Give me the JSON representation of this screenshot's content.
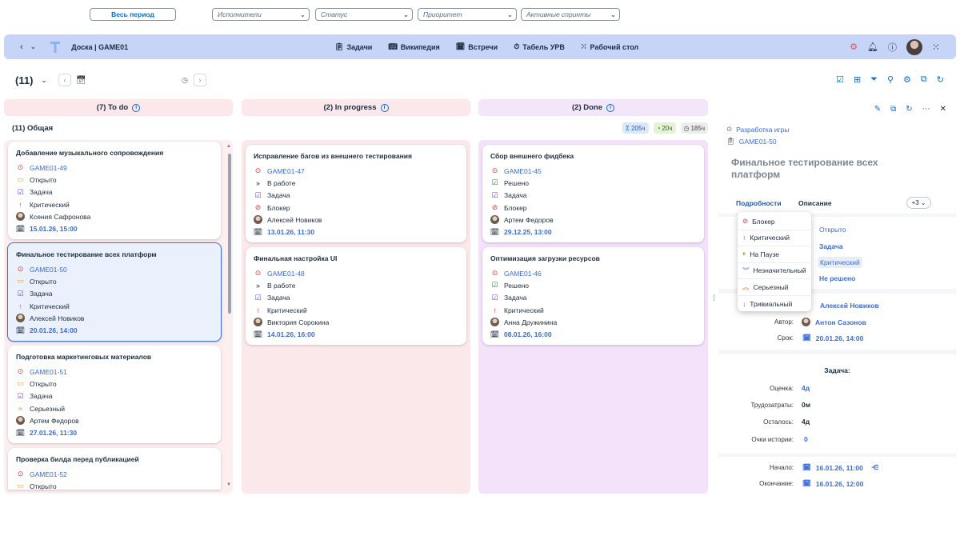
{
  "header": {
    "title": "Доска | GAME01",
    "menu": [
      {
        "label": "Задачи",
        "icon": "clipboard-icon"
      },
      {
        "label": "Википедия",
        "icon": "book-icon"
      },
      {
        "label": "Встречи",
        "icon": "calendar-people-icon"
      },
      {
        "label": "Табель УРВ",
        "icon": "clock-sheet-icon"
      },
      {
        "label": "Рабочий стол",
        "icon": "grid-dots-icon"
      }
    ]
  },
  "filters": {
    "count": "(11)",
    "period": "Весь период",
    "assignees": "Исполнители",
    "status": "Статус",
    "priority": "Приоритет",
    "sprints": "Активные спринты"
  },
  "board": {
    "group_title": "(11) Общая",
    "badges": [
      {
        "label": "205ч",
        "icon": "sigma-icon",
        "bg": "#dbe8fb",
        "color": "#1d5bbf"
      },
      {
        "label": "20ч",
        "icon": "check-icon",
        "bg": "#e3f3d6",
        "color": "#2f6b1a"
      },
      {
        "label": "185ч",
        "icon": "hourglass-icon",
        "bg": "#ececec",
        "color": "#444"
      }
    ],
    "columns": [
      {
        "title": "(7) To do",
        "bg": "#fce8ea",
        "body_bg": "#fdeef0"
      },
      {
        "title": "(2) In progress",
        "bg": "#fce8ea",
        "body_bg": "#fbe8ea"
      },
      {
        "title": "(2) Done",
        "bg": "#f3e6fa",
        "body_bg": "#f3e2f9"
      }
    ],
    "todo_cards": [
      {
        "title": "Добавление музыкального сопровождения",
        "key": "GAME01-49",
        "status": "Открыто",
        "type": "Задача",
        "priority": "Критический",
        "assignee": "Ксения Сафронова",
        "date": "15.01.26, 15:00"
      },
      {
        "title": "Финальное тестирование всех платформ",
        "key": "GAME01-50",
        "status": "Открыто",
        "type": "Задача",
        "priority": "Критический",
        "assignee": "Алексей Новиков",
        "date": "20.01.26, 14:00"
      },
      {
        "title": "Подготовка маркетинговых материалов",
        "key": "GAME01-51",
        "status": "Открыто",
        "type": "Задача",
        "priority": "Серьезный",
        "assignee": "Артем Федоров",
        "date": "27.01.26, 11:30"
      },
      {
        "title": "Проверка билда перед публикацией",
        "key": "GAME01-52",
        "status": "Открыто"
      }
    ],
    "progress_cards": [
      {
        "title": "Исправление багов из внешнего тестирования",
        "key": "GAME01-47",
        "status": "В работе",
        "type": "Задача",
        "priority": "Блокер",
        "assignee": "Алексей Новиков",
        "date": "13.01.26, 11:30"
      },
      {
        "title": "Финальная настройка UI",
        "key": "GAME01-48",
        "status": "В работе",
        "type": "Задача",
        "priority": "Критический",
        "assignee": "Виктория Сорокина",
        "date": "14.01.26, 16:00"
      }
    ],
    "done_cards": [
      {
        "title": "Сбор внешнего фидбека",
        "key": "GAME01-45",
        "status": "Решено",
        "type": "Задача",
        "priority": "Блокер",
        "assignee": "Артем Федоров",
        "date": "29.12.25, 13:00"
      },
      {
        "title": "Оптимизация загрузки ресурсов",
        "key": "GAME01-46",
        "status": "Решено",
        "type": "Задача",
        "priority": "Критический",
        "assignee": "Анна Дружинина",
        "date": "08.01.26, 16:00"
      }
    ]
  },
  "detail": {
    "project": "Разработка игры",
    "key": "GAME01-50",
    "title": "Финальное тестирование всех платформ",
    "tabs": [
      "Подробности",
      "Описание"
    ],
    "more_tabs": "+3",
    "fields_values": [
      "Открыто",
      "Задача",
      "Критический",
      "Не решено"
    ],
    "assignee": "Алексей Новиков",
    "author_label": "Автор:",
    "author": "Антон Сазонов",
    "due_label": "Срок:",
    "due": "20.01.26, 14:00",
    "task_header": "Задача:",
    "estimate_label": "Оценка:",
    "estimate": "4д",
    "spent_label": "Трудозатраты:",
    "spent": "0м",
    "remaining_label": "Осталось:",
    "remaining": "4д",
    "points_label": "Очки истории:",
    "points": "0",
    "start_label": "Начало:",
    "start": "16.01.26, 11:00",
    "end_label": "Окончание:",
    "end": "16.01.26, 12:00"
  },
  "priority_dropdown": [
    {
      "label": "Блокер",
      "icon": "blocked-icon",
      "color": "#d9363e"
    },
    {
      "label": "Критический",
      "icon": "arrow-up-icon",
      "color": "#d9363e"
    },
    {
      "label": "На Паузе",
      "icon": "pause-icon",
      "color": "#7cb82f"
    },
    {
      "label": "Незначительный",
      "icon": "double-chevron-down-icon",
      "color": "#3b6bd6"
    },
    {
      "label": "Серьезный",
      "icon": "double-chevron-up-icon",
      "color": "#e8732b"
    },
    {
      "label": "Тривиальный",
      "icon": "arrow-down-icon",
      "color": "#556b82"
    }
  ]
}
